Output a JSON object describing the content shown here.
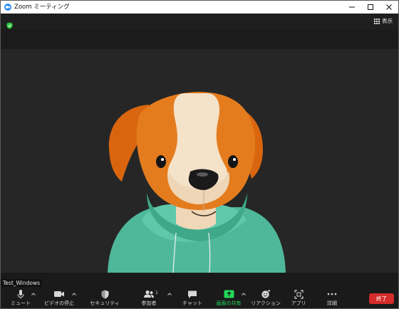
{
  "window": {
    "title": "Zoom ミーティング"
  },
  "topbar": {
    "view_label": "表示"
  },
  "participant": {
    "name": "Test_Windows"
  },
  "toolbar": {
    "mute_label": "ミュート",
    "video_label": "ビデオの停止",
    "security_label": "セキュリティ",
    "participants_label": "参加者",
    "participants_count": "1",
    "chat_label": "チャット",
    "share_label": "画面の共有",
    "reactions_label": "リアクション",
    "apps_label": "アプリ",
    "more_label": "詳細",
    "end_label": "終了"
  },
  "colors": {
    "accent_green": "#23d959",
    "end_red": "#d42b2b",
    "zoom_blue": "#2d8cff",
    "shield_green": "#2ecc40"
  },
  "icons": [
    "zoom-logo-icon",
    "minimize-icon",
    "maximize-icon",
    "close-icon",
    "encryption-shield-icon",
    "grid-view-icon",
    "microphone-icon",
    "video-camera-icon",
    "security-shield-icon",
    "participants-icon",
    "chat-icon",
    "share-screen-icon",
    "reaction-icon",
    "apps-icon",
    "more-icon"
  ]
}
